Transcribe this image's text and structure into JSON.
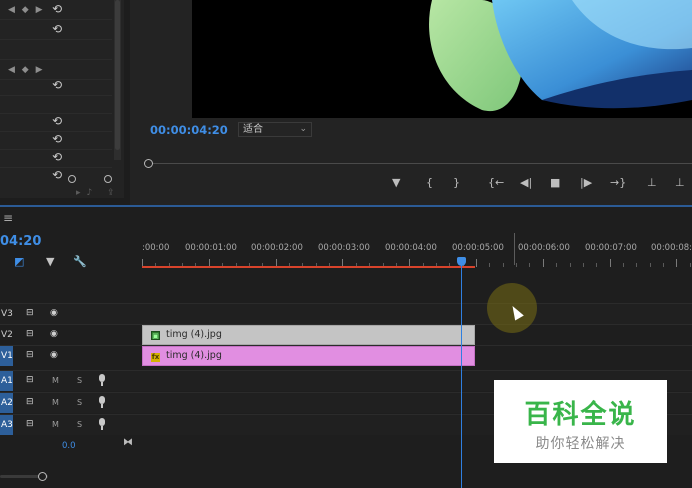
{
  "effect_controls": {
    "keyframe_nav_symbol": "◀ ◆ ▶",
    "reset_icon": "undo-icon",
    "rows": [
      {
        "has_nav": true
      },
      {
        "has_nav": false
      },
      {
        "has_nav": false
      },
      {
        "has_nav": true
      },
      {
        "has_nav": false
      },
      {
        "has_nav": false
      },
      {
        "has_nav": false
      },
      {
        "has_nav": false
      },
      {
        "has_nav": false
      },
      {
        "has_nav": false
      }
    ]
  },
  "program_monitor": {
    "timecode": "00:00:04:20",
    "fit_select": {
      "value": "适合"
    },
    "transport": {
      "add_marker": "▼",
      "mark_in": "{",
      "mark_out": "}",
      "go_to_in": "{←",
      "step_back": "◀|",
      "stop": "■",
      "step_forward": "|▶",
      "go_to_out": "→}",
      "lift": "⊥",
      "extract": "⊥"
    }
  },
  "timeline": {
    "menu_icon": "≡",
    "timecode": "04:20",
    "ruler_labels": [
      ":00:00",
      "00:00:01:00",
      "00:00:02:00",
      "00:00:03:00",
      "00:00:04:00",
      "00:00:05:00",
      "00:00:06:00",
      "00:00:07:00",
      "00:00:08:"
    ],
    "tracks": [
      {
        "name": "V3",
        "type": "video",
        "selected": false
      },
      {
        "name": "V2",
        "type": "video",
        "selected": false
      },
      {
        "name": "V1",
        "type": "video",
        "selected": true
      },
      {
        "name": "A1",
        "type": "audio",
        "selected": true
      },
      {
        "name": "A2",
        "type": "audio",
        "selected": true
      },
      {
        "name": "A3",
        "type": "audio",
        "selected": true
      }
    ],
    "mute_label": "M",
    "solo_label": "S",
    "clips": {
      "v2": {
        "label": "timg (4).jpg",
        "badge": "▣"
      },
      "v1": {
        "label": "timg (4).jpg",
        "badge": "fx"
      }
    },
    "volume_value": "0.0",
    "bowtie_icon": "⧓"
  },
  "watermark": {
    "title": "百科全说",
    "subtitle": "助你轻松解决"
  },
  "colors": {
    "accent_blue": "#3f8ee6",
    "work_area_red": "#d8432b",
    "clip_pink": "#e18ee1",
    "clip_gray": "#c4c4c4",
    "watermark_green": "#39b54a"
  }
}
